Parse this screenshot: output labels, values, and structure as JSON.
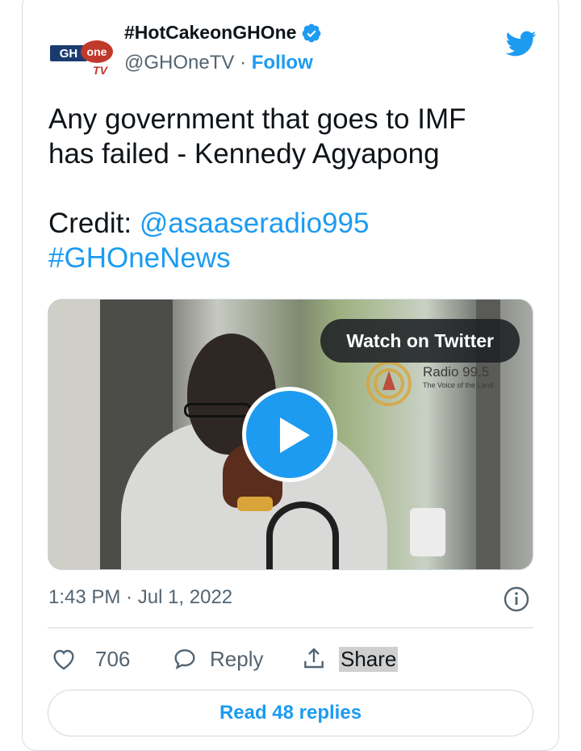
{
  "tweet": {
    "account": {
      "name": "#HotCakeonGHOne",
      "handle": "@GHOneTV",
      "separator": "·",
      "follow_label": "Follow",
      "avatar_text_1": "GH",
      "avatar_text_2": "one",
      "avatar_text_3": "TV",
      "brand_colors": [
        "#1d9bf0",
        "#c0392b"
      ]
    },
    "text": {
      "line1": "Any government that goes to IMF",
      "line2": "has failed - Kennedy Agyapong",
      "credit_label": "Credit: ",
      "credit_handle": "@asaaseradio995",
      "hashtag": "#GHOneNews"
    },
    "media": {
      "watch_label": "Watch on Twitter",
      "radio_name": "Radio 99.5",
      "radio_tagline": "The Voice of the Land",
      "play_icon": "play-icon"
    },
    "meta": {
      "time": "1:43 PM",
      "separator": "·",
      "date": "Jul 1, 2022",
      "info_icon": "info-icon"
    },
    "actions": {
      "like_count": "706",
      "reply_label": "Reply",
      "share_label": "Share"
    },
    "read_replies_label": "Read 48 replies"
  }
}
